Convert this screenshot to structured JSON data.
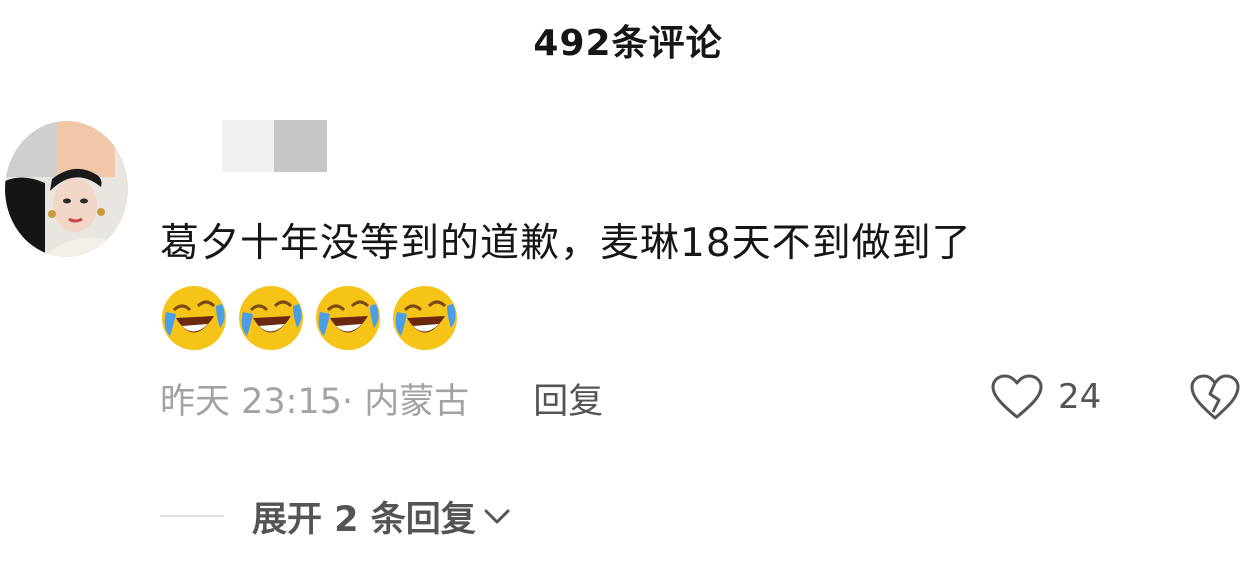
{
  "header": {
    "title": "492条评论"
  },
  "comment": {
    "text": "葛夕十年没等到的道歉，麦琳18天不到做到了",
    "emojis": [
      {
        "icon": "laugh-cry-emoji"
      },
      {
        "icon": "laugh-cry-emoji"
      },
      {
        "icon": "laugh-cry-emoji"
      },
      {
        "icon": "laugh-cry-emoji"
      }
    ],
    "meta": "昨天 23:15· 内蒙古",
    "reply_label": "回复",
    "like_count": "24",
    "like_icon": "heart-icon",
    "dislike_icon": "broken-heart-icon"
  },
  "expand": {
    "label": "展开 2 条回复",
    "icon": "chevron-down-icon"
  },
  "colors": {
    "text_primary": "#161616",
    "text_secondary": "#545454",
    "text_muted": "#a3a3a3",
    "emoji_yellow": "#f6c318",
    "emoji_tear": "#4a9ee8"
  }
}
